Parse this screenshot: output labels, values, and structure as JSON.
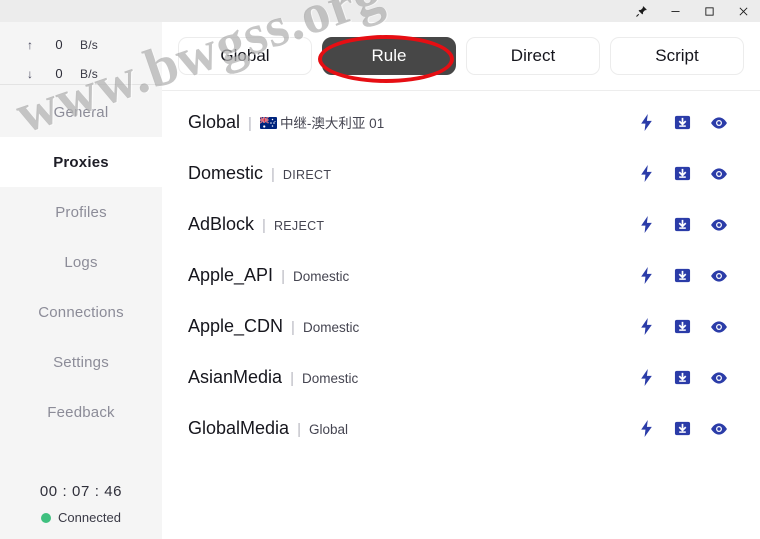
{
  "window": {
    "controls": [
      {
        "name": "pin-icon",
        "label": "Pin"
      },
      {
        "name": "minimize-icon",
        "label": "Minimize"
      },
      {
        "name": "maximize-icon",
        "label": "Maximize"
      },
      {
        "name": "close-icon",
        "label": "Close"
      }
    ]
  },
  "sidebar": {
    "speeds": {
      "upload": {
        "arrow": "↑",
        "value": "0",
        "unit": "B/s"
      },
      "download": {
        "arrow": "↓",
        "value": "0",
        "unit": "B/s"
      }
    },
    "items": [
      {
        "label": "General",
        "selected": false
      },
      {
        "label": "Proxies",
        "selected": true
      },
      {
        "label": "Profiles",
        "selected": false
      },
      {
        "label": "Logs",
        "selected": false
      },
      {
        "label": "Connections",
        "selected": false
      },
      {
        "label": "Settings",
        "selected": false
      },
      {
        "label": "Feedback",
        "selected": false
      }
    ],
    "footer": {
      "timer": "00 : 07 : 46",
      "status": "Connected",
      "status_color": "#3fc07f"
    }
  },
  "main": {
    "tabs": [
      {
        "label": "Global",
        "active": false
      },
      {
        "label": "Rule",
        "active": true
      },
      {
        "label": "Direct",
        "active": false
      },
      {
        "label": "Script",
        "active": false
      }
    ],
    "rows": [
      {
        "name": "Global",
        "value": "中继-澳大利亚 01",
        "flag": "au",
        "style": "normal"
      },
      {
        "name": "Domestic",
        "value": "DIRECT",
        "flag": null,
        "style": "caps"
      },
      {
        "name": "AdBlock",
        "value": "REJECT",
        "flag": null,
        "style": "caps"
      },
      {
        "name": "Apple_API",
        "value": "Domestic",
        "flag": null,
        "style": "normal"
      },
      {
        "name": "Apple_CDN",
        "value": "Domestic",
        "flag": null,
        "style": "normal"
      },
      {
        "name": "AsianMedia",
        "value": "Domestic",
        "flag": null,
        "style": "normal"
      },
      {
        "name": "GlobalMedia",
        "value": "Global",
        "flag": null,
        "style": "normal"
      }
    ],
    "row_actions": [
      {
        "name": "speed-test-icon",
        "title": "Speed test"
      },
      {
        "name": "download-box-icon",
        "title": "Download"
      },
      {
        "name": "eye-icon",
        "title": "Show"
      }
    ],
    "separator": "|",
    "accent_color": "#2b3ca8"
  },
  "overlay": {
    "watermark": "www.bwgss.org",
    "annotation_color": "#e60e13"
  }
}
